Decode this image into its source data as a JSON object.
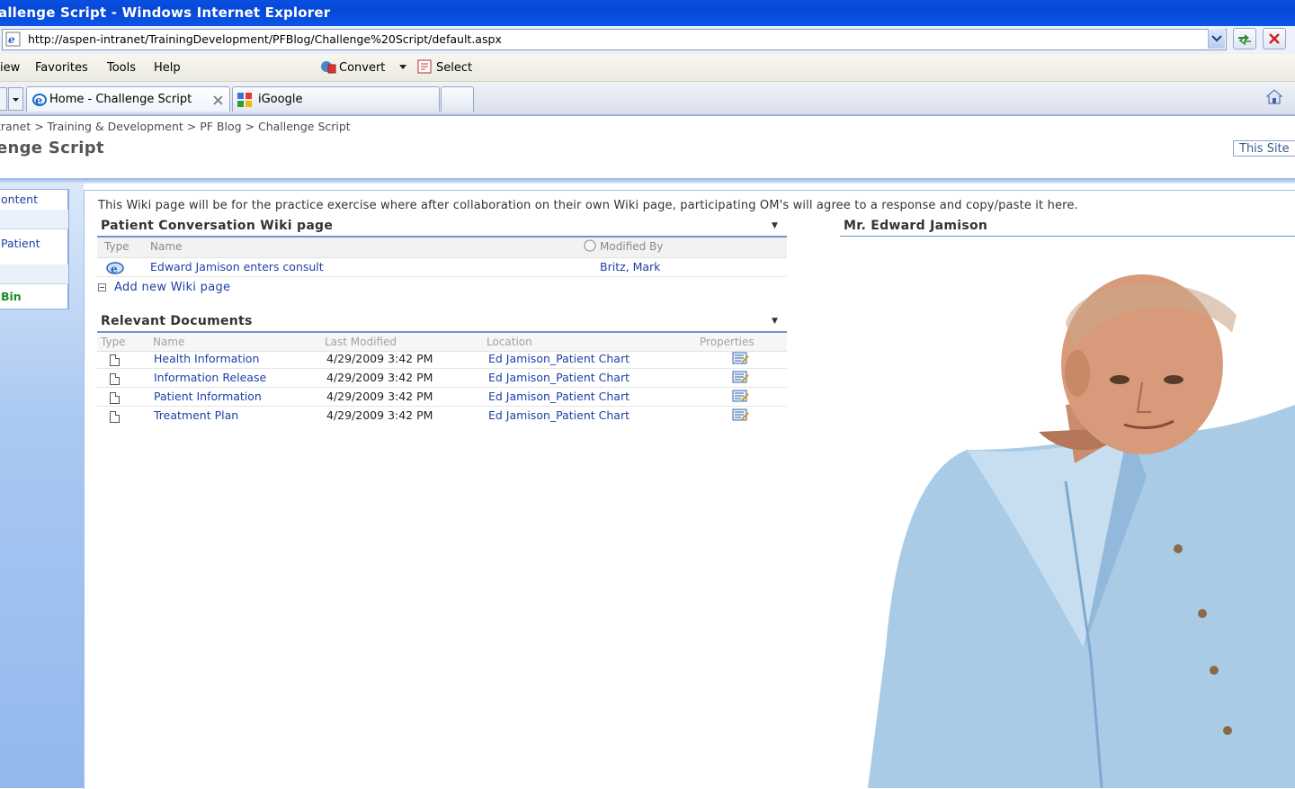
{
  "window": {
    "title": "allenge Script - Windows Internet Explorer"
  },
  "address_bar": {
    "url": "http://aspen-intranet/TrainingDevelopment/PFBlog/Challenge%20Script/default.aspx"
  },
  "menu_bar": {
    "items": [
      "iew",
      "Favorites",
      "Tools",
      "Help"
    ],
    "convert_label": "Convert",
    "select_label": "Select"
  },
  "tabs": [
    {
      "label": "Home - Challenge Script",
      "active": true
    },
    {
      "label": "iGoogle",
      "active": false
    }
  ],
  "page": {
    "breadcrumb": "tranet > Training & Development > PF Blog > Challenge Script",
    "title": "enge Script",
    "search_scope": "This Site"
  },
  "left_nav": {
    "items": [
      "ontent",
      "",
      "Patient",
      "",
      "Bin"
    ]
  },
  "intro_text": "This Wiki page will be for the practice exercise where after collaboration on their own Wiki page, participating OM's will agree to a response and copy/paste it here.",
  "wiki_section": {
    "title": "Patient Conversation Wiki page",
    "columns": {
      "type": "Type",
      "name": "Name",
      "modified_by": "Modified By"
    },
    "rows": [
      {
        "name": "Edward Jamison enters consult",
        "modified_by": "Britz, Mark"
      }
    ],
    "add_link": "Add new Wiki page"
  },
  "documents_section": {
    "title": "Relevant Documents",
    "columns": {
      "type": "Type",
      "name": "Name",
      "modified": "Last Modified",
      "location": "Location",
      "properties": "Properties"
    },
    "rows": [
      {
        "name": "Health Information",
        "modified": "4/29/2009 3:42 PM",
        "location": "Ed Jamison_Patient Chart"
      },
      {
        "name": "Information Release",
        "modified": "4/29/2009 3:42 PM",
        "location": "Ed Jamison_Patient Chart"
      },
      {
        "name": "Patient Information",
        "modified": "4/29/2009 3:42 PM",
        "location": "Ed Jamison_Patient Chart"
      },
      {
        "name": "Treatment Plan",
        "modified": "4/29/2009 3:42 PM",
        "location": "Ed Jamison_Patient Chart"
      }
    ]
  },
  "patient_section": {
    "title": "Mr. Edward Jamison"
  },
  "colors": {
    "titlebar": "#0648d6",
    "link": "#1f3fa6",
    "section_rule": "#6f94c8",
    "left_nav": "#a9c8f1"
  }
}
